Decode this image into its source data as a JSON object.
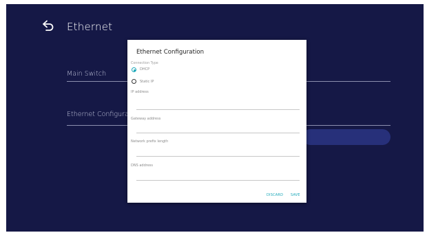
{
  "page": {
    "title": "Ethernet"
  },
  "rows": [
    {
      "label": "Main Switch"
    },
    {
      "label": "Ethernet Configuratio"
    }
  ],
  "dialog": {
    "title": "Ethernet Configuration",
    "connection_type_label": "Connection Type",
    "options": [
      {
        "label": "DHCP",
        "selected": true
      },
      {
        "label": "Static IP",
        "selected": false
      }
    ],
    "fields": [
      {
        "label": "IP address",
        "value": ""
      },
      {
        "label": "Gateway address",
        "value": ""
      },
      {
        "label": "Network prefix length",
        "value": ""
      },
      {
        "label": "DNS address",
        "value": ""
      }
    ],
    "discard_label": "DISCARD",
    "save_label": "SAVE"
  },
  "colors": {
    "background": "#151846",
    "accent": "#1aa7b8",
    "highlight": "#27307a"
  },
  "icons": {
    "back": "back-arrow-icon"
  }
}
